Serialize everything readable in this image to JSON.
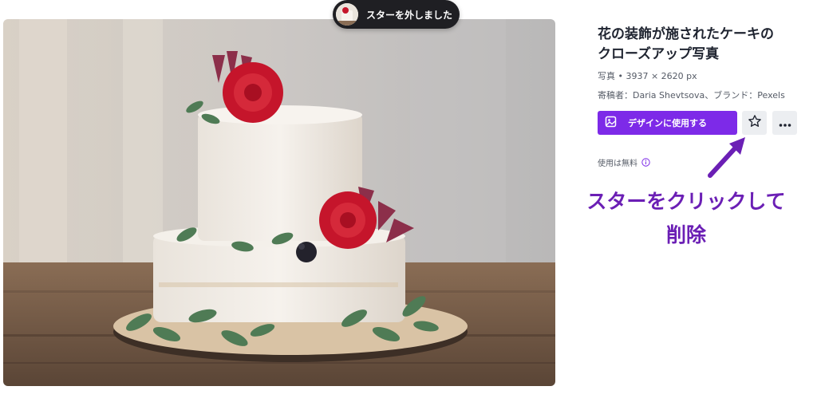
{
  "toast": {
    "message": "スターを外しました",
    "thumb_icon": "cake-thumbnail"
  },
  "asset": {
    "title_line1": "花の装飾が施されたケーキの",
    "title_line2": "クローズアップ写真",
    "meta": "写真 • 3937 × 2620 px",
    "author": "寄稿者：Daria Shevtsova、ブランド：Pexels",
    "image_icon": "cake-photo"
  },
  "actions": {
    "use_in_design": "デザインに使用する",
    "use_icon": "image-icon",
    "star_icon": "star-icon",
    "more_icon": "more-icon"
  },
  "license": {
    "text": "使用は無料",
    "icon": "info-icon"
  },
  "annotation": {
    "line1": "スターをクリックして",
    "line2": "削除",
    "color": "#6b1fb5"
  },
  "colors": {
    "accent": "#7d2ae8",
    "toast_bg": "#1f1f23"
  }
}
